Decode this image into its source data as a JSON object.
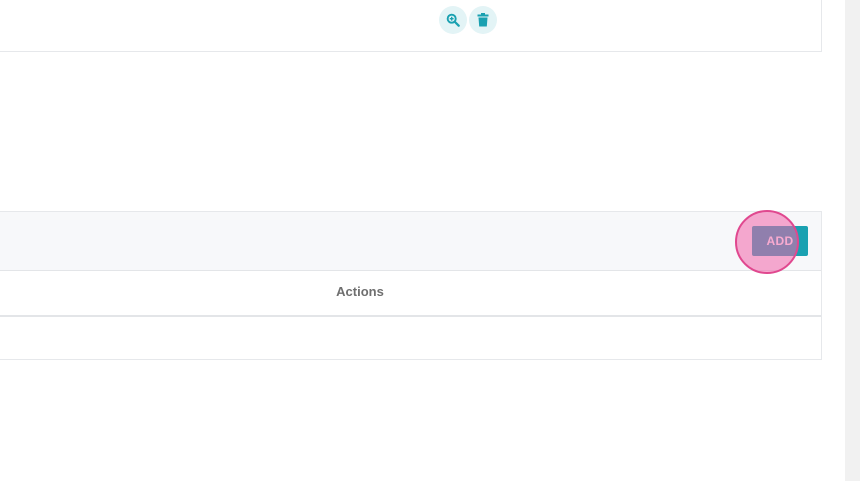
{
  "top_table": {
    "actions": [
      {
        "name": "zoom",
        "icon": "zoom-in-icon"
      },
      {
        "name": "delete",
        "icon": "trash-icon"
      }
    ]
  },
  "bottom_table": {
    "add_label": "ADD",
    "columns": [
      "Actions"
    ],
    "rows": []
  },
  "colors": {
    "accent": "#1aa1b1",
    "icon_bg": "#e3f4f6",
    "header_bg": "#f7f8fa",
    "click_marker": "#e0488f"
  }
}
